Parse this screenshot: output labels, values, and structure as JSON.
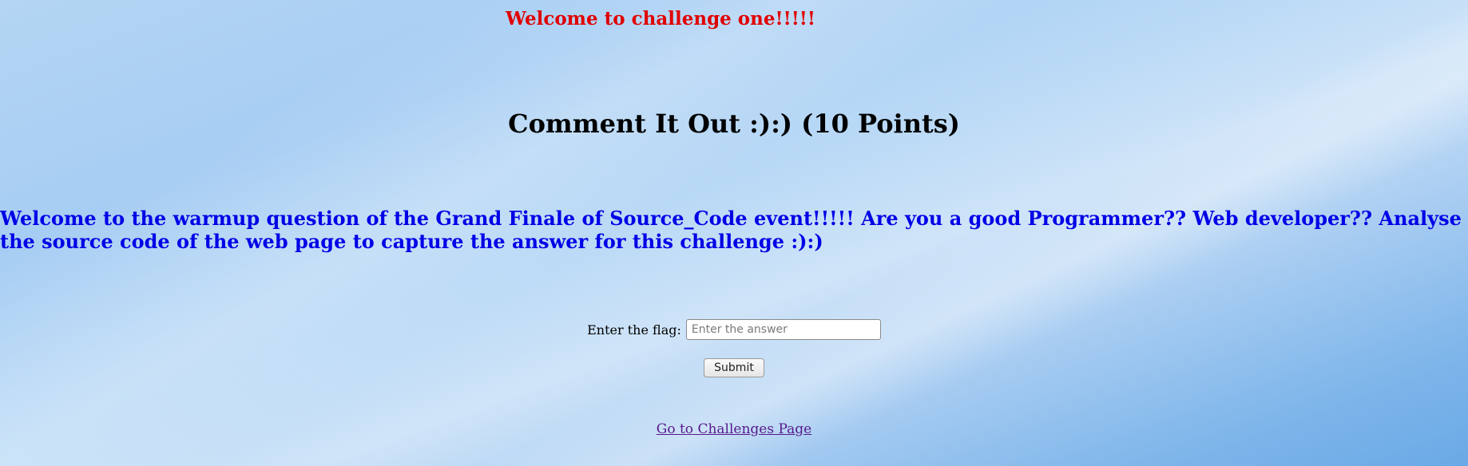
{
  "header": {
    "greeting": "Welcome to challenge one!!!!!"
  },
  "challenge": {
    "title": "Comment It Out :):) (10 Points)",
    "intro": "Welcome to the warmup question of the Grand Finale of Source_Code event!!!!! Are you a good Programmer?? Web developer?? Analyse the source code of the web page to capture the answer for this challenge :):)"
  },
  "form": {
    "flag_label": "Enter the flag:",
    "flag_placeholder": "Enter the answer",
    "flag_value": "",
    "submit_label": "Submit"
  },
  "footer": {
    "challenges_link": "Go to Challenges Page"
  },
  "colors": {
    "greeting": "#e00000",
    "intro": "#0000e6",
    "link_visited": "#551a8b"
  }
}
